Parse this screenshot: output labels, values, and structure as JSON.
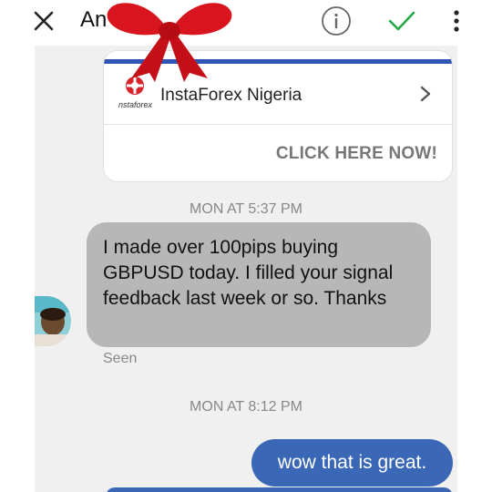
{
  "header": {
    "title": "An",
    "close_icon": "close-icon",
    "info_icon": "info-icon",
    "check_icon": "check-icon",
    "more_icon": "more-vertical-icon",
    "check_color": "#22a845"
  },
  "ad": {
    "brand_name": "InstaForex Nigeria",
    "logo_text": "nstaforex",
    "cta": "CLICK HERE NOW!",
    "accent_color": "#2f56b5",
    "logo_color": "#d9232a"
  },
  "messages": {
    "timestamp_1": "MON AT 5:37 PM",
    "incoming_text": "I made over 100pips buying GBPUSD today. I filled your signal feedback last week or so. Thanks",
    "seen_label": "Seen",
    "timestamp_2": "MON AT 8:12 PM",
    "outgoing_text": "wow that is great."
  },
  "colors": {
    "incoming_bubble": "#b7b7b7",
    "outgoing_bubble": "#3a68b7",
    "bow": "#d8141e"
  }
}
